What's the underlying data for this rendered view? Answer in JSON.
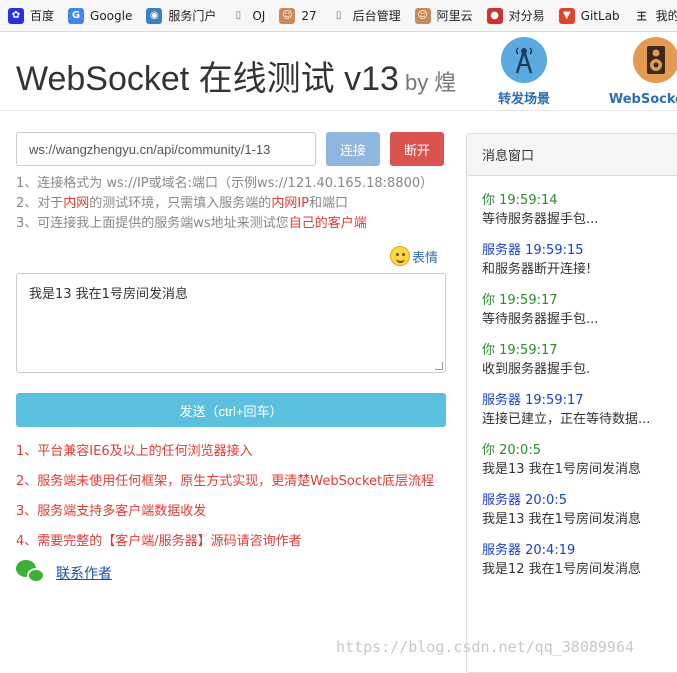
{
  "bookmarks": [
    {
      "label": "百度",
      "icon": "baidu-paw-icon",
      "color": "#2932e1"
    },
    {
      "label": "Google",
      "icon": "google-icon",
      "color": "#4285f4"
    },
    {
      "label": "服务门户",
      "icon": "portal-icon",
      "color": "#3b7fc4"
    },
    {
      "label": "OJ",
      "icon": "page-icon",
      "color": "#777777"
    },
    {
      "label": "27",
      "icon": "avatar-icon",
      "color": "#c98a5a"
    },
    {
      "label": "后台管理",
      "icon": "page-icon",
      "color": "#777777"
    },
    {
      "label": "阿里云",
      "icon": "avatar-icon",
      "color": "#c98a5a"
    },
    {
      "label": "对分易",
      "icon": "dui-icon",
      "color": "#d32f2f"
    },
    {
      "label": "GitLab",
      "icon": "gitlab-icon",
      "color": "#e24329"
    },
    {
      "label": "我的",
      "icon": "wo-icon",
      "color": "#333333"
    }
  ],
  "header": {
    "title": "WebSocket 在线测试 v13",
    "by": "by 煌",
    "links": [
      {
        "label": "转发场景",
        "icon": "antenna-icon",
        "color": "#5aa9df"
      },
      {
        "label": "WebSocket客",
        "icon": "speaker-icon",
        "color": "#e39b52"
      }
    ]
  },
  "connect": {
    "url": "ws://wangzhengyu.cn/api/community/1-13",
    "connect_label": "连接",
    "disconnect_label": "断开"
  },
  "hints": {
    "line1": "1、连接格式为 ws://IP或域名:端口（示例ws://121.40.165.18:8800）",
    "line2_a": "2、对于",
    "line2_b": "内网",
    "line2_c": "的测试环境，只需填入服务端的",
    "line2_d": "内网IP",
    "line2_e": "和端口",
    "line3_a": "3、可连接我上面提供的服务端ws地址来测试您",
    "line3_b": "自己的客户端"
  },
  "emoji_label": "表情",
  "message_text": "我是13 我在1号房间发消息",
  "send_label": "发送（ctrl+回车）",
  "notes": [
    "1、平台兼容IE6及以上的任何浏览器接入",
    "2、服务端未使用任何框架，原生方式实现，更清楚WebSocket底层流程",
    "3、服务端支持多客户端数据收发",
    "4、需要完整的【客户端/服务器】源码请咨询作者"
  ],
  "contact_label": "联系作者",
  "panel": {
    "title": "消息窗口",
    "messages": [
      {
        "who": "你 19:59:14",
        "role": "me",
        "body": "等待服务器握手包..."
      },
      {
        "who": "服务器 19:59:15",
        "role": "srv",
        "body": "和服务器断开连接!"
      },
      {
        "who": "你 19:59:17",
        "role": "me",
        "body": "等待服务器握手包..."
      },
      {
        "who": "你 19:59:17",
        "role": "me",
        "body": "收到服务器握手包."
      },
      {
        "who": "服务器 19:59:17",
        "role": "srv",
        "body": "连接已建立，正在等待数据..."
      },
      {
        "who": "你 20:0:5",
        "role": "me",
        "body": "我是13 我在1号房间发消息"
      },
      {
        "who": "服务器 20:0:5",
        "role": "srv",
        "body": "我是13 我在1号房间发消息"
      },
      {
        "who": "服务器 20:4:19",
        "role": "srv",
        "body": "我是12 我在1号房间发消息"
      }
    ]
  },
  "watermark": "https://blog.csdn.net/qq_38089964"
}
